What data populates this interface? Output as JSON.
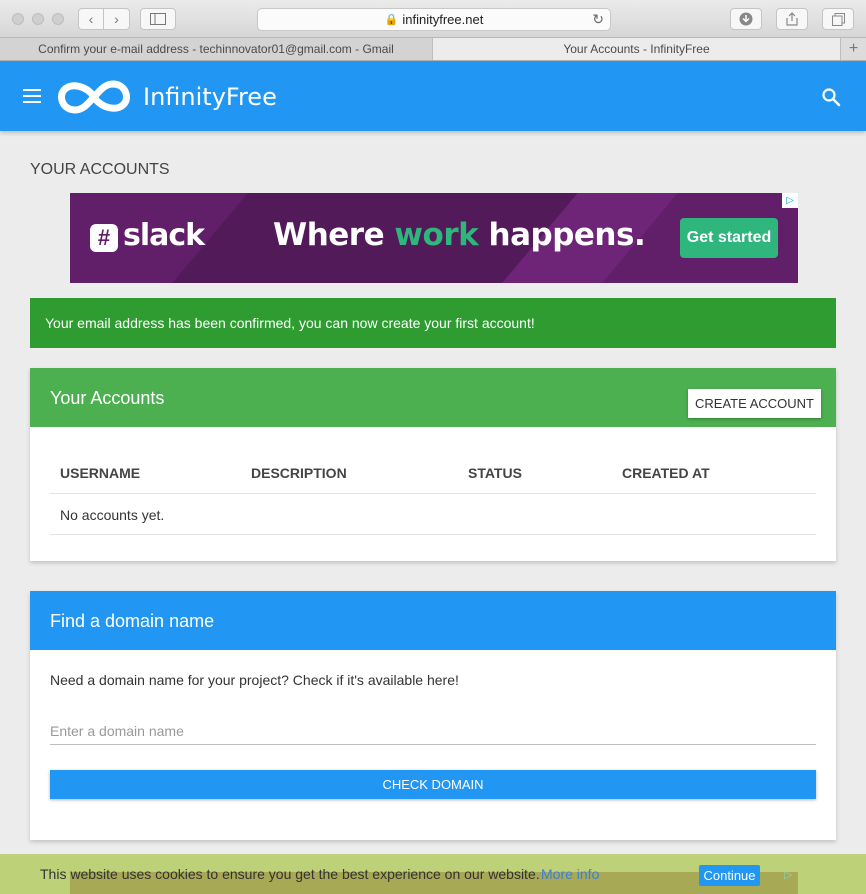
{
  "browser": {
    "url": "infinityfree.net",
    "tabs": [
      {
        "label": "Confirm your e-mail address - techinnovator01@gmail.com - Gmail"
      },
      {
        "label": "Your Accounts - InfinityFree"
      }
    ]
  },
  "header": {
    "brand": "InfinityFree"
  },
  "page": {
    "title": "YOUR ACCOUNTS"
  },
  "ad": {
    "logo": "slack",
    "headline_pre": "Where ",
    "headline_hl": "work",
    "headline_post": " happens.",
    "cta": "Get started"
  },
  "alert": {
    "message": "Your email address has been confirmed, you can now create your first account!"
  },
  "accounts": {
    "title": "Your Accounts",
    "create_label": "CREATE ACCOUNT",
    "columns": [
      "USERNAME",
      "DESCRIPTION",
      "STATUS",
      "CREATED AT"
    ],
    "empty": "No accounts yet."
  },
  "domain": {
    "title": "Find a domain name",
    "text": "Need a domain name for your project? Check if it's available here!",
    "placeholder": "Enter a domain name",
    "button": "CHECK DOMAIN"
  },
  "cookie": {
    "text": "This website uses cookies to ensure you get the best experience on our website.",
    "more": "More info",
    "button": "Continue"
  },
  "colors": {
    "primary": "#2196f3",
    "success": "#2e9c31",
    "card_header_green": "#4caf50",
    "slack_purple": "#611f69",
    "slack_green": "#2eb67d"
  }
}
